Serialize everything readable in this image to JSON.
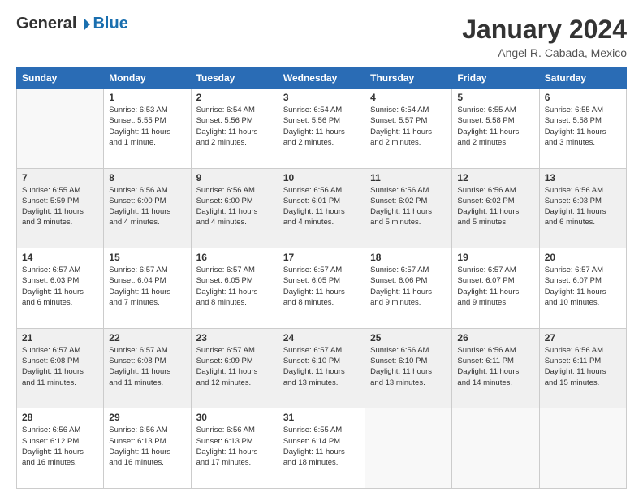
{
  "header": {
    "logo_general": "General",
    "logo_blue": "Blue",
    "month_title": "January 2024",
    "location": "Angel R. Cabada, Mexico"
  },
  "weekdays": [
    "Sunday",
    "Monday",
    "Tuesday",
    "Wednesday",
    "Thursday",
    "Friday",
    "Saturday"
  ],
  "weeks": [
    [
      {
        "day": "",
        "sunrise": "",
        "sunset": "",
        "daylight": ""
      },
      {
        "day": "1",
        "sunrise": "Sunrise: 6:53 AM",
        "sunset": "Sunset: 5:55 PM",
        "daylight": "Daylight: 11 hours and 1 minute."
      },
      {
        "day": "2",
        "sunrise": "Sunrise: 6:54 AM",
        "sunset": "Sunset: 5:56 PM",
        "daylight": "Daylight: 11 hours and 2 minutes."
      },
      {
        "day": "3",
        "sunrise": "Sunrise: 6:54 AM",
        "sunset": "Sunset: 5:56 PM",
        "daylight": "Daylight: 11 hours and 2 minutes."
      },
      {
        "day": "4",
        "sunrise": "Sunrise: 6:54 AM",
        "sunset": "Sunset: 5:57 PM",
        "daylight": "Daylight: 11 hours and 2 minutes."
      },
      {
        "day": "5",
        "sunrise": "Sunrise: 6:55 AM",
        "sunset": "Sunset: 5:58 PM",
        "daylight": "Daylight: 11 hours and 2 minutes."
      },
      {
        "day": "6",
        "sunrise": "Sunrise: 6:55 AM",
        "sunset": "Sunset: 5:58 PM",
        "daylight": "Daylight: 11 hours and 3 minutes."
      }
    ],
    [
      {
        "day": "7",
        "sunrise": "Sunrise: 6:55 AM",
        "sunset": "Sunset: 5:59 PM",
        "daylight": "Daylight: 11 hours and 3 minutes."
      },
      {
        "day": "8",
        "sunrise": "Sunrise: 6:56 AM",
        "sunset": "Sunset: 6:00 PM",
        "daylight": "Daylight: 11 hours and 4 minutes."
      },
      {
        "day": "9",
        "sunrise": "Sunrise: 6:56 AM",
        "sunset": "Sunset: 6:00 PM",
        "daylight": "Daylight: 11 hours and 4 minutes."
      },
      {
        "day": "10",
        "sunrise": "Sunrise: 6:56 AM",
        "sunset": "Sunset: 6:01 PM",
        "daylight": "Daylight: 11 hours and 4 minutes."
      },
      {
        "day": "11",
        "sunrise": "Sunrise: 6:56 AM",
        "sunset": "Sunset: 6:02 PM",
        "daylight": "Daylight: 11 hours and 5 minutes."
      },
      {
        "day": "12",
        "sunrise": "Sunrise: 6:56 AM",
        "sunset": "Sunset: 6:02 PM",
        "daylight": "Daylight: 11 hours and 5 minutes."
      },
      {
        "day": "13",
        "sunrise": "Sunrise: 6:56 AM",
        "sunset": "Sunset: 6:03 PM",
        "daylight": "Daylight: 11 hours and 6 minutes."
      }
    ],
    [
      {
        "day": "14",
        "sunrise": "Sunrise: 6:57 AM",
        "sunset": "Sunset: 6:03 PM",
        "daylight": "Daylight: 11 hours and 6 minutes."
      },
      {
        "day": "15",
        "sunrise": "Sunrise: 6:57 AM",
        "sunset": "Sunset: 6:04 PM",
        "daylight": "Daylight: 11 hours and 7 minutes."
      },
      {
        "day": "16",
        "sunrise": "Sunrise: 6:57 AM",
        "sunset": "Sunset: 6:05 PM",
        "daylight": "Daylight: 11 hours and 8 minutes."
      },
      {
        "day": "17",
        "sunrise": "Sunrise: 6:57 AM",
        "sunset": "Sunset: 6:05 PM",
        "daylight": "Daylight: 11 hours and 8 minutes."
      },
      {
        "day": "18",
        "sunrise": "Sunrise: 6:57 AM",
        "sunset": "Sunset: 6:06 PM",
        "daylight": "Daylight: 11 hours and 9 minutes."
      },
      {
        "day": "19",
        "sunrise": "Sunrise: 6:57 AM",
        "sunset": "Sunset: 6:07 PM",
        "daylight": "Daylight: 11 hours and 9 minutes."
      },
      {
        "day": "20",
        "sunrise": "Sunrise: 6:57 AM",
        "sunset": "Sunset: 6:07 PM",
        "daylight": "Daylight: 11 hours and 10 minutes."
      }
    ],
    [
      {
        "day": "21",
        "sunrise": "Sunrise: 6:57 AM",
        "sunset": "Sunset: 6:08 PM",
        "daylight": "Daylight: 11 hours and 11 minutes."
      },
      {
        "day": "22",
        "sunrise": "Sunrise: 6:57 AM",
        "sunset": "Sunset: 6:08 PM",
        "daylight": "Daylight: 11 hours and 11 minutes."
      },
      {
        "day": "23",
        "sunrise": "Sunrise: 6:57 AM",
        "sunset": "Sunset: 6:09 PM",
        "daylight": "Daylight: 11 hours and 12 minutes."
      },
      {
        "day": "24",
        "sunrise": "Sunrise: 6:57 AM",
        "sunset": "Sunset: 6:10 PM",
        "daylight": "Daylight: 11 hours and 13 minutes."
      },
      {
        "day": "25",
        "sunrise": "Sunrise: 6:56 AM",
        "sunset": "Sunset: 6:10 PM",
        "daylight": "Daylight: 11 hours and 13 minutes."
      },
      {
        "day": "26",
        "sunrise": "Sunrise: 6:56 AM",
        "sunset": "Sunset: 6:11 PM",
        "daylight": "Daylight: 11 hours and 14 minutes."
      },
      {
        "day": "27",
        "sunrise": "Sunrise: 6:56 AM",
        "sunset": "Sunset: 6:11 PM",
        "daylight": "Daylight: 11 hours and 15 minutes."
      }
    ],
    [
      {
        "day": "28",
        "sunrise": "Sunrise: 6:56 AM",
        "sunset": "Sunset: 6:12 PM",
        "daylight": "Daylight: 11 hours and 16 minutes."
      },
      {
        "day": "29",
        "sunrise": "Sunrise: 6:56 AM",
        "sunset": "Sunset: 6:13 PM",
        "daylight": "Daylight: 11 hours and 16 minutes."
      },
      {
        "day": "30",
        "sunrise": "Sunrise: 6:56 AM",
        "sunset": "Sunset: 6:13 PM",
        "daylight": "Daylight: 11 hours and 17 minutes."
      },
      {
        "day": "31",
        "sunrise": "Sunrise: 6:55 AM",
        "sunset": "Sunset: 6:14 PM",
        "daylight": "Daylight: 11 hours and 18 minutes."
      },
      {
        "day": "",
        "sunrise": "",
        "sunset": "",
        "daylight": ""
      },
      {
        "day": "",
        "sunrise": "",
        "sunset": "",
        "daylight": ""
      },
      {
        "day": "",
        "sunrise": "",
        "sunset": "",
        "daylight": ""
      }
    ]
  ]
}
